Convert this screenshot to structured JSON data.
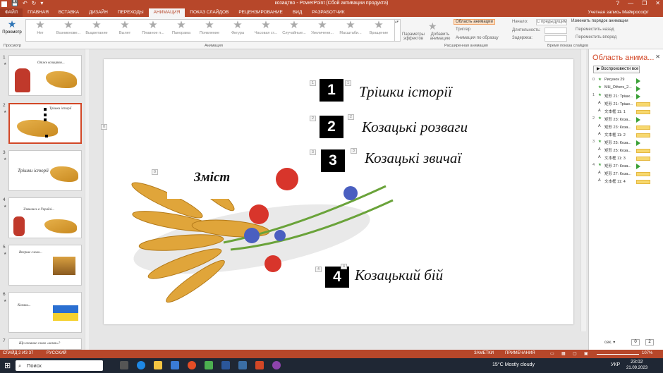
{
  "window": {
    "title": "козацтво - PowerPoint (Сбой активации продукта)",
    "help": "?",
    "minimize": "—",
    "restore": "❐",
    "close": "✕"
  },
  "qat": {
    "save": "💾",
    "undo": "↶",
    "redo": "↻",
    "more": "▾"
  },
  "tabs": [
    {
      "label": "ФАЙЛ"
    },
    {
      "label": "ГЛАВНАЯ"
    },
    {
      "label": "ВСТАВКА"
    },
    {
      "label": "ДИЗАЙН"
    },
    {
      "label": "ПЕРЕХОДЫ"
    },
    {
      "label": "АНИМАЦИЯ"
    },
    {
      "label": "ПОКАЗ СЛАЙДОВ"
    },
    {
      "label": "РЕЦЕНЗИРОВАНИЕ"
    },
    {
      "label": "ВИД"
    },
    {
      "label": "РАЗРАБОТЧИК"
    }
  ],
  "account": "Учетная запись Майкрософт",
  "ribbon": {
    "preview_label": "Просмотр",
    "preview_group": "Просмотр",
    "effects": [
      "Нет",
      "Возникнове...",
      "Выцветание",
      "Вылет",
      "Плавное п...",
      "Панорама",
      "Появление",
      "Фигура",
      "Часовая ст...",
      "Случайные...",
      "Увеличени...",
      "Масштаби...",
      "Вращение"
    ],
    "animation_group": "Анимация",
    "effect_params": "Параметры эффектов",
    "add_animation": "Добавить анимацию",
    "anim_pane_btn": "Область анимации",
    "trigger": "Триггер",
    "anim_painter": "Анимация по образцу",
    "advanced_group": "Расширенная анимация",
    "start_label": "Начало:",
    "start_value": "С предыдущим",
    "duration_label": "Длительность:",
    "delay_label": "Задержка:",
    "timing_group": "Время показа слайдов",
    "reorder_title": "Изменить порядок анимации",
    "move_earlier": "Переместить назад",
    "move_later": "Переместить вперед"
  },
  "thumbnails": [
    {
      "num": "1",
      "text": "Отже козацтво..."
    },
    {
      "num": "2",
      "text": "Трішки історії"
    },
    {
      "num": "3",
      "text": "Трішки історії"
    },
    {
      "num": "4",
      "text": "З'явились в Україні..."
    },
    {
      "num": "5",
      "text": "Вперше слово..."
    },
    {
      "num": "6",
      "text": "Козаки..."
    },
    {
      "num": "7",
      "text": "Що означає слово «козак»?"
    }
  ],
  "slide": {
    "items": [
      {
        "num": "1",
        "text": "Трішки історії"
      },
      {
        "num": "2",
        "text": "Козацькі розваги"
      },
      {
        "num": "3",
        "text": "Козацькі звичаї"
      },
      {
        "num": "4",
        "text": "Козацький бій"
      }
    ],
    "heading": "Зміст",
    "tags": [
      "1",
      "1",
      "2",
      "2",
      "3",
      "3",
      "4",
      "4",
      "0",
      "0"
    ]
  },
  "anim_pane": {
    "title": "Область анима...",
    "play_all": "Воспроизвести все",
    "rows": [
      {
        "seq": "0",
        "icon": "★",
        "label": "Рисунок 29"
      },
      {
        "seq": "",
        "icon": "★",
        "label": "MH_Others_2..."
      },
      {
        "seq": "1",
        "icon": "★",
        "label": "矩形 21: Трішк..."
      },
      {
        "seq": "",
        "icon": "A",
        "label": "矩形 21: Трішк..."
      },
      {
        "seq": "",
        "icon": "A",
        "label": "文本框 11: 1"
      },
      {
        "seq": "2",
        "icon": "★",
        "label": "矩形 23: Коза..."
      },
      {
        "seq": "",
        "icon": "A",
        "label": "矩形 23: Коза..."
      },
      {
        "seq": "",
        "icon": "A",
        "label": "文本框 11: 2"
      },
      {
        "seq": "3",
        "icon": "★",
        "label": "矩形 25: Коза..."
      },
      {
        "seq": "",
        "icon": "A",
        "label": "矩形 25: Коза..."
      },
      {
        "seq": "",
        "icon": "A",
        "label": "文本框 11: 3"
      },
      {
        "seq": "4",
        "icon": "★",
        "label": "矩形 27: Коза..."
      },
      {
        "seq": "",
        "icon": "A",
        "label": "矩形 27: Коза..."
      },
      {
        "seq": "",
        "icon": "A",
        "label": "文本框 11: 4"
      }
    ],
    "seconds_label": "сек. ▾",
    "page_from": "0",
    "page_to": "2"
  },
  "status": {
    "slide": "СЛАЙД 2 ИЗ 37",
    "lang": "РУССКИЙ",
    "notes": "ЗАМЕТКИ",
    "comments": "ПРИМЕЧАНИЯ",
    "zoom": "107%"
  },
  "taskbar": {
    "search": "Поиск",
    "weather": "15°C  Mostly cloudy",
    "lang": "УКР",
    "time": "23:02",
    "date": "21.09.2023"
  },
  "colors": {
    "accent": "#b7472a",
    "selected_border": "#d24726",
    "anim_bar": "#f7d86e"
  }
}
